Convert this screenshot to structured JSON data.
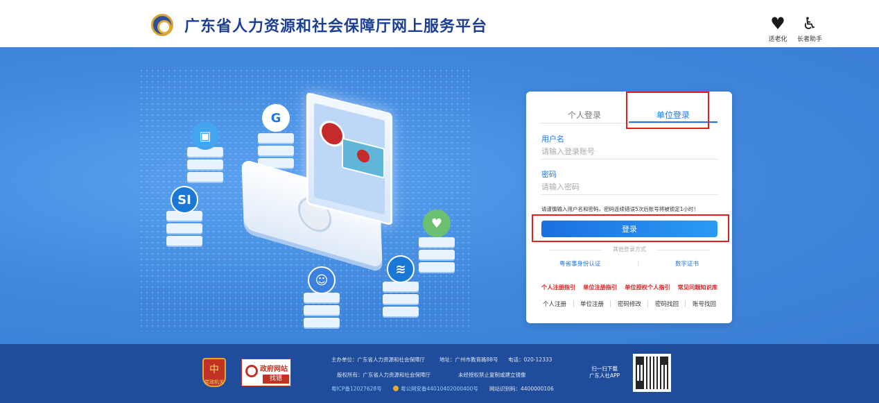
{
  "header": {
    "title": "广东省人力资源和社会保障厅网上服务平台",
    "tools": [
      {
        "label": "适老化",
        "icon": "elder-care-icon"
      },
      {
        "label": "长者助手",
        "icon": "wheelchair-icon"
      }
    ]
  },
  "hero": {
    "icons": [
      "briefcase-icon",
      "g-logo-icon",
      "si-logo-icon",
      "handshake-icon",
      "people-icon",
      "wave-logo-icon"
    ]
  },
  "login": {
    "tabs": [
      {
        "label": "个人登录",
        "active": false
      },
      {
        "label": "单位登录",
        "active": true
      }
    ],
    "username": {
      "label": "用户名",
      "placeholder": "请输入登录账号",
      "value": ""
    },
    "password": {
      "label": "密码",
      "placeholder": "请输入密码",
      "value": ""
    },
    "tip": "请谨慎输入用户名和密码，密码连续错误5次后账号将被锁定1小时！",
    "submit_label": "登录",
    "other_methods_label": "其他登录方式",
    "alt_methods": [
      "粤省事身份认证",
      "数字证书"
    ],
    "guides": [
      "个人注册指引",
      "单位注册指引",
      "单位授权个人指引",
      "常见问题知识库"
    ],
    "links": [
      "个人注册",
      "单位注册",
      "密码修改",
      "密码找回",
      "账号找回"
    ]
  },
  "footer": {
    "badge_label": "党政机关",
    "gov_site": {
      "title": "政府网站",
      "action": "找错"
    },
    "line1": {
      "sponsor": "主办单位：广东省人力资源和社会保障厅",
      "address": "地址：广州市教育路88号",
      "phone": "电话：020-12333"
    },
    "line2": {
      "copyright": "版权所有：广东省人力资源和社会保障厅",
      "notice": "未经授权禁止复制或建立镜像"
    },
    "line3": {
      "icp": "粤ICP备12027628号",
      "police": "粤公网安备44010402000400号",
      "site_code": "网站识别码：4400000106"
    },
    "scan": {
      "line1": "扫一扫下载",
      "line2": "广东人社APP"
    }
  },
  "colors": {
    "primary": "#1e78e6",
    "brand_text": "#1c3f95",
    "footer_bg": "#1f4c9b",
    "highlight": "#e02020",
    "guide_red": "#e02020"
  }
}
